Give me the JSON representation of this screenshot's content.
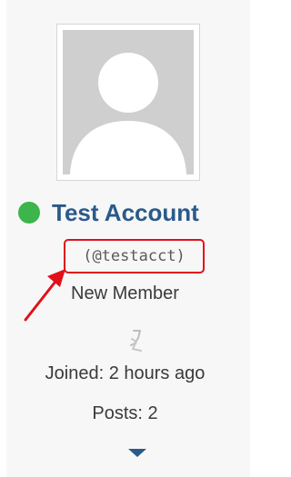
{
  "profile": {
    "display_name": "Test Account",
    "handle": "(@testacct)",
    "role": "New Member",
    "joined": "Joined: 2 hours ago",
    "posts": "Posts: 2",
    "online_status": "online"
  },
  "colors": {
    "name": "#2a5a8a",
    "online": "#3cb54a",
    "highlight": "#e0111a"
  },
  "icons": {
    "avatar": "default-avatar-silhouette",
    "trophy": "trophy-icon",
    "expand": "caret-down-icon",
    "annotation": "red-arrow-annotation"
  }
}
